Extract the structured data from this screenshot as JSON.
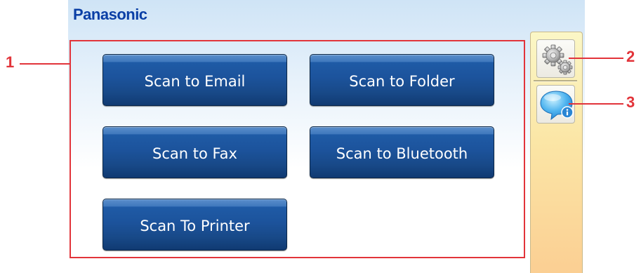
{
  "header": {
    "brand": "Panasonic"
  },
  "main": {
    "buttons": [
      {
        "label": "Scan to Email"
      },
      {
        "label": "Scan to Folder"
      },
      {
        "label": "Scan to Fax"
      },
      {
        "label": "Scan to Bluetooth"
      },
      {
        "label": "Scan To Printer"
      }
    ]
  },
  "sidebar": {
    "settings_icon": "gears-icon",
    "info_icon": "info-speech-bubble-icon"
  },
  "callouts": {
    "one": "1",
    "two": "2",
    "three": "3"
  },
  "colors": {
    "brand_blue": "#0a3fa6",
    "button_blue": "#1c539c",
    "callout_red": "#e2343a"
  }
}
